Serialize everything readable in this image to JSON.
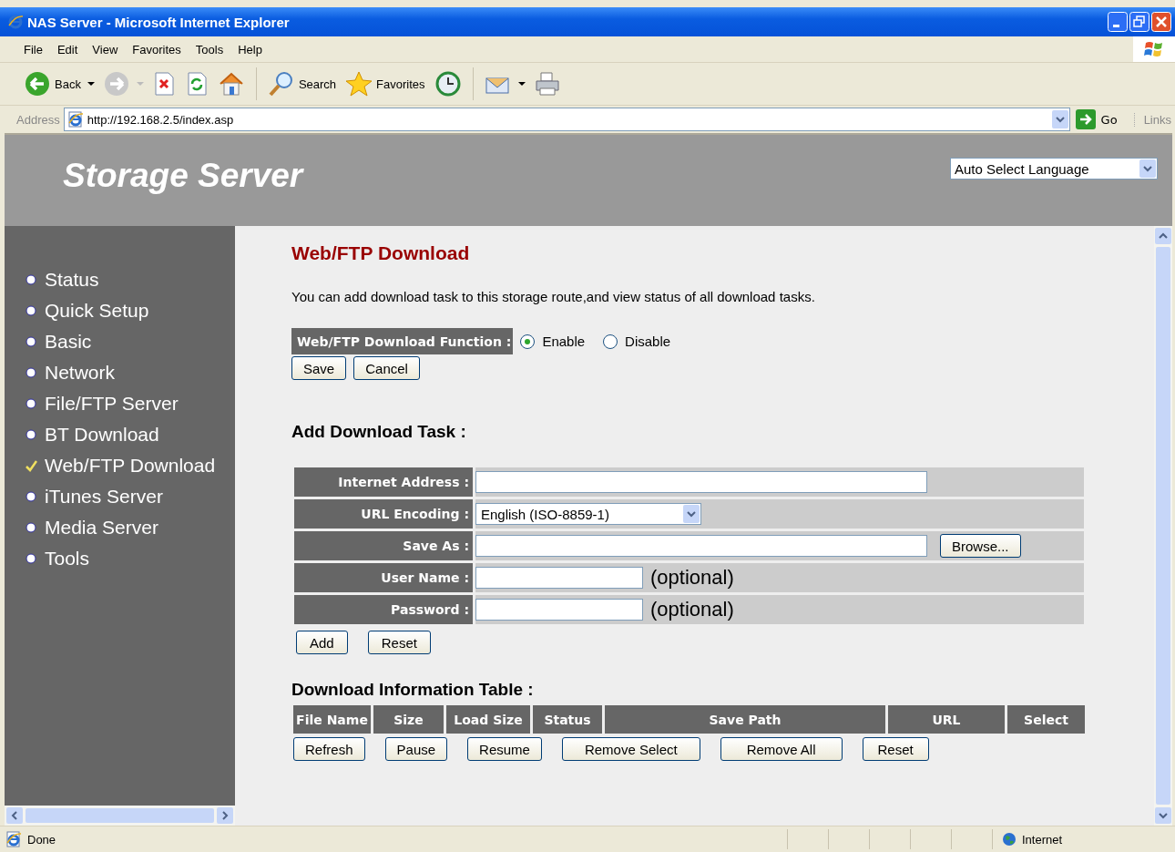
{
  "window": {
    "title": "NAS Server - Microsoft Internet Explorer"
  },
  "menu": [
    "File",
    "Edit",
    "View",
    "Favorites",
    "Tools",
    "Help"
  ],
  "toolbar": {
    "back": "Back",
    "search": "Search",
    "favorites": "Favorites"
  },
  "address_bar": {
    "label": "Address",
    "url": "http://192.168.2.5/index.asp",
    "go": "Go",
    "links": "Links"
  },
  "header": {
    "title": "Storage Server",
    "language": "Auto Select Language"
  },
  "sidebar": {
    "items": [
      {
        "label": "Status",
        "selected": false
      },
      {
        "label": "Quick Setup",
        "selected": false
      },
      {
        "label": "Basic",
        "selected": false
      },
      {
        "label": "Network",
        "selected": false
      },
      {
        "label": "File/FTP Server",
        "selected": false
      },
      {
        "label": "BT Download",
        "selected": false
      },
      {
        "label": "Web/FTP Download",
        "selected": true
      },
      {
        "label": "iTunes Server",
        "selected": false
      },
      {
        "label": "Media Server",
        "selected": false
      },
      {
        "label": "Tools",
        "selected": false
      }
    ]
  },
  "content": {
    "heading": "Web/FTP Download",
    "description": "You can add download task to this storage route,and view status of all download tasks.",
    "function": {
      "label": "Web/FTP Download Function :",
      "options": [
        {
          "label": "Enable",
          "selected": true
        },
        {
          "label": "Disable",
          "selected": false
        }
      ]
    },
    "function_buttons": [
      "Save",
      "Cancel"
    ],
    "add_task": {
      "title": "Add Download Task :",
      "rows": [
        {
          "kind": "wide",
          "label": "Internet Address :"
        },
        {
          "kind": "select",
          "label": "URL Encoding :",
          "value": "English (ISO-8859-1)"
        },
        {
          "kind": "file",
          "label": "Save As  :",
          "button": "Browse..."
        },
        {
          "kind": "short",
          "label": "User Name  :",
          "note": "(optional)"
        },
        {
          "kind": "short",
          "label": "Password :",
          "note": "(optional)"
        }
      ],
      "buttons": [
        "Add",
        "Reset"
      ]
    },
    "table": {
      "title": "Download Information Table :",
      "columns": [
        "File Name",
        "Size",
        "Load Size",
        "Status",
        "Save Path",
        "URL",
        "Select"
      ],
      "buttons": [
        "Refresh",
        "Pause",
        "Resume",
        "Remove Select",
        "Remove All",
        "Reset"
      ]
    }
  },
  "status_bar": {
    "text": "Done",
    "zone": "Internet"
  }
}
